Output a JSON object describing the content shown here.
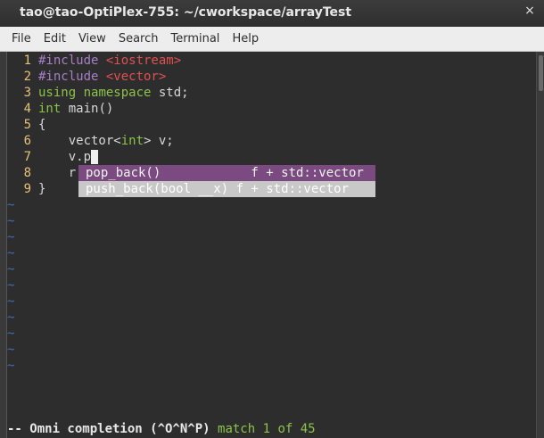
{
  "window": {
    "title": "tao@tao-OptiPlex-755: ~/cworkspace/arrayTest",
    "close_glyph": "×"
  },
  "menu": {
    "items": [
      "File",
      "Edit",
      "View",
      "Search",
      "Terminal",
      "Help"
    ]
  },
  "editor": {
    "lines": [
      {
        "num": "1",
        "parts": [
          {
            "t": "#include ",
            "c": "kw-pre"
          },
          {
            "t": "<iostream>",
            "c": "inc"
          }
        ]
      },
      {
        "num": "2",
        "parts": [
          {
            "t": "#include ",
            "c": "kw-pre"
          },
          {
            "t": "<vector>",
            "c": "inc"
          }
        ]
      },
      {
        "num": "3",
        "parts": [
          {
            "t": "using",
            "c": "kw"
          },
          {
            "t": " ",
            "c": ""
          },
          {
            "t": "namespace",
            "c": "kw"
          },
          {
            "t": " std;",
            "c": ""
          }
        ]
      },
      {
        "num": "4",
        "parts": [
          {
            "t": "int",
            "c": "kw"
          },
          {
            "t": " main()",
            "c": ""
          }
        ]
      },
      {
        "num": "5",
        "parts": [
          {
            "t": "{",
            "c": ""
          }
        ]
      },
      {
        "num": "6",
        "parts": [
          {
            "t": "    vector<",
            "c": ""
          },
          {
            "t": "int",
            "c": "kw"
          },
          {
            "t": "> v;",
            "c": ""
          }
        ]
      },
      {
        "num": "7",
        "parts": [
          {
            "t": "    v.p",
            "c": ""
          }
        ],
        "cursor": true
      },
      {
        "num": "8",
        "parts": [
          {
            "t": "    r",
            "c": ""
          }
        ]
      },
      {
        "num": "9",
        "parts": [
          {
            "t": "}",
            "c": ""
          }
        ]
      }
    ],
    "tilde_count": 11,
    "tilde_char": "~"
  },
  "completion": {
    "items": [
      {
        "text": "pop_back()            f + std::vector",
        "selected": true
      },
      {
        "text": "push_back(bool __x) f + std::vector",
        "selected": false
      }
    ]
  },
  "status": {
    "mode": "-- Omni completion (^O^N^P) ",
    "match": "match 1 of 45"
  },
  "colors": {
    "preprocessor": "#a87ec7",
    "include_target": "#e05050",
    "keyword": "#8bc34a",
    "line_number": "#e5c07b",
    "popup_selected": "#7a4a80",
    "popup_normal": "#c8c8c8"
  }
}
